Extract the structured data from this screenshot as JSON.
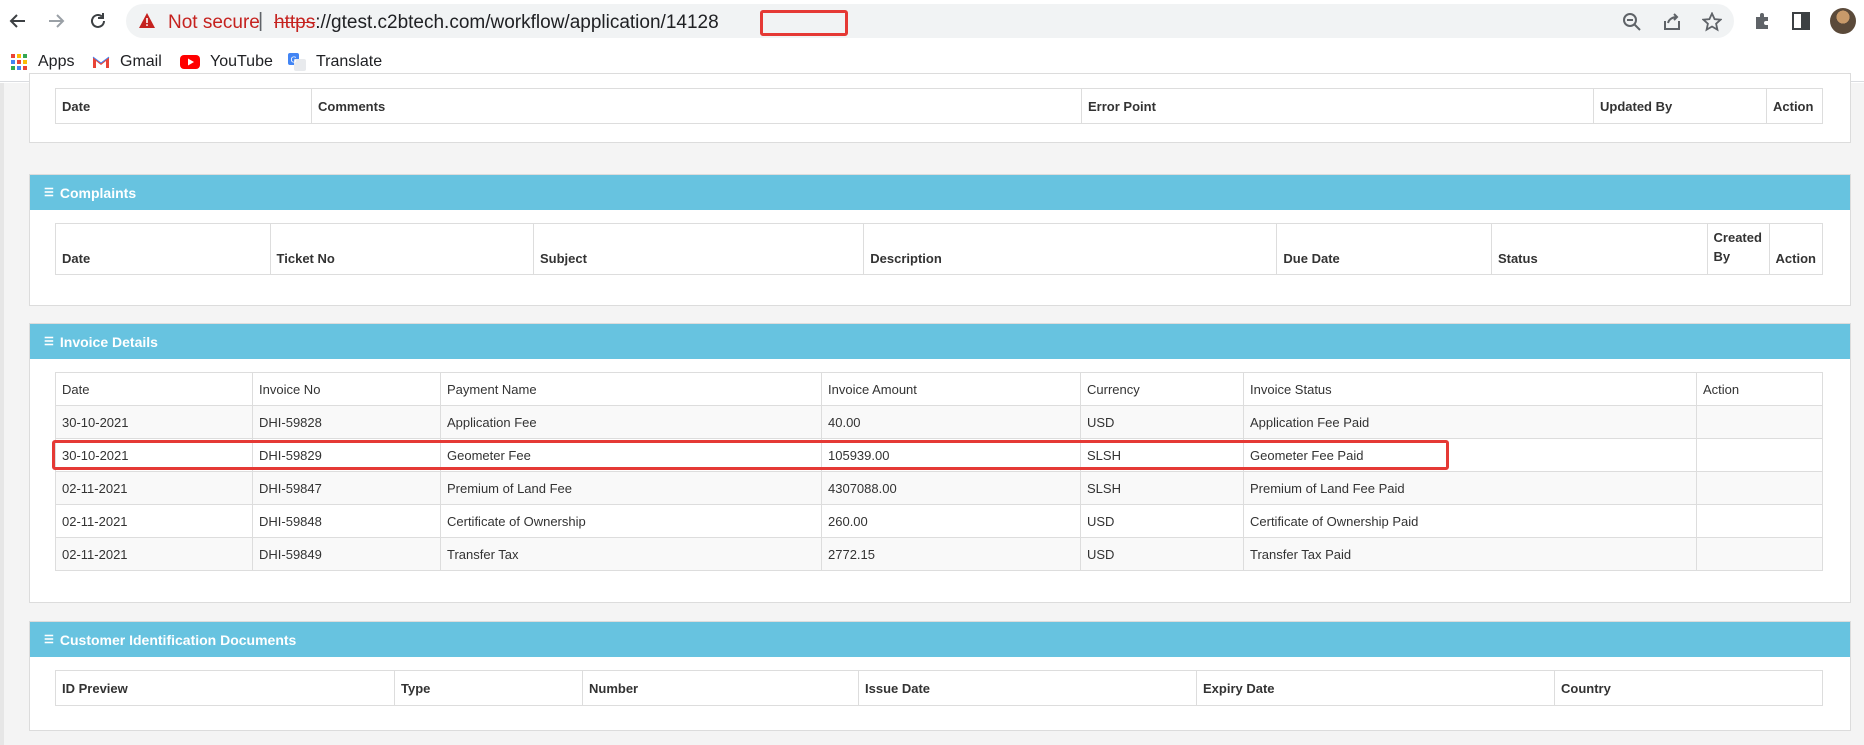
{
  "browser": {
    "security_label": "Not secure",
    "separator": "|",
    "url_scheme": "https",
    "url_rest": "://gtest.c2btech.com/workflow/application/14128",
    "bookmarks": [
      {
        "label": "Apps",
        "icon": "apps-grid-icon"
      },
      {
        "label": "Gmail",
        "icon": "gmail-icon"
      },
      {
        "label": "YouTube",
        "icon": "youtube-icon"
      },
      {
        "label": "Translate",
        "icon": "translate-icon"
      }
    ]
  },
  "history_table": {
    "headers": [
      "Date",
      "Comments",
      "Error Point",
      "Updated By",
      "Action"
    ]
  },
  "complaints": {
    "title": "Complaints",
    "headers": [
      "Date",
      "Ticket No",
      "Subject",
      "Description",
      "Due Date",
      "Status",
      "Created By",
      "Action"
    ]
  },
  "invoice": {
    "title": "Invoice Details",
    "headers": [
      "Date",
      "Invoice No",
      "Payment Name",
      "Invoice Amount",
      "Currency",
      "Invoice Status",
      "Action"
    ],
    "rows": [
      [
        "30-10-2021",
        "DHI-59828",
        "Application Fee",
        "40.00",
        "USD",
        "Application Fee Paid",
        ""
      ],
      [
        "30-10-2021",
        "DHI-59829",
        "Geometer Fee",
        "105939.00",
        "SLSH",
        "Geometer Fee Paid",
        ""
      ],
      [
        "02-11-2021",
        "DHI-59847",
        "Premium of Land Fee",
        "4307088.00",
        "SLSH",
        "Premium of Land Fee Paid",
        ""
      ],
      [
        "02-11-2021",
        "DHI-59848",
        "Certificate of Ownership",
        "260.00",
        "USD",
        "Certificate of Ownership Paid",
        ""
      ],
      [
        "02-11-2021",
        "DHI-59849",
        "Transfer Tax",
        "2772.15",
        "USD",
        "Transfer Tax Paid",
        ""
      ]
    ]
  },
  "customer_docs": {
    "title": "Customer Identification Documents",
    "headers": [
      "ID Preview",
      "Type",
      "Number",
      "Issue Date",
      "Expiry Date",
      "Country"
    ]
  },
  "colors": {
    "panel_header": "#67c3e0",
    "highlight": "#e53935",
    "not_secure": "#c5221f"
  }
}
